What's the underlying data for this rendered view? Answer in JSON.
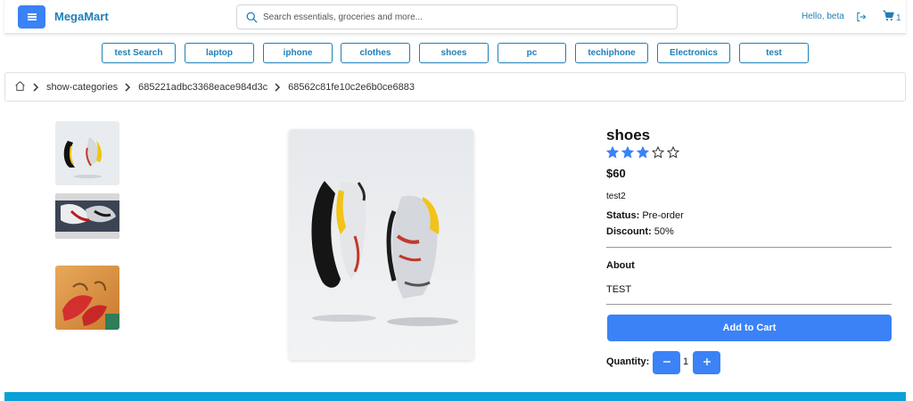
{
  "header": {
    "app_name": "MegaMart",
    "search_placeholder": "Search essentials, groceries and more...",
    "greeting": "Hello, beta",
    "cart_count": "1",
    "menu_icon": "hamburger-menu-icon",
    "logout_icon": "logout-icon",
    "cart_icon": "shopping-cart-icon",
    "search_icon": "search-icon"
  },
  "categories": [
    "test Search",
    "laptop",
    "iphone",
    "clothes",
    "shoes",
    "pc",
    "techiphone",
    "Electronics",
    "test"
  ],
  "breadcrumb": {
    "home_icon": "home-icon",
    "items": [
      "show-categories",
      "685221adbc3368eace984d3c",
      "68562c81fe10c2e6b0ce6883"
    ]
  },
  "product": {
    "title": "shoes",
    "rating": 3,
    "rating_max": 5,
    "price": "$60",
    "description": "test2",
    "status_label": "Status:",
    "status_value": "Pre-order",
    "discount_label": "Discount:",
    "discount_value": "50%",
    "about_heading": "About",
    "about_text": "TEST",
    "add_to_cart": "Add to Cart",
    "quantity_label": "Quantity:",
    "quantity": "1"
  },
  "colors": {
    "accent": "#3b82f6",
    "brand": "#1f7fb8",
    "star": "#3b82f6",
    "footer": "#0aa1d6"
  }
}
